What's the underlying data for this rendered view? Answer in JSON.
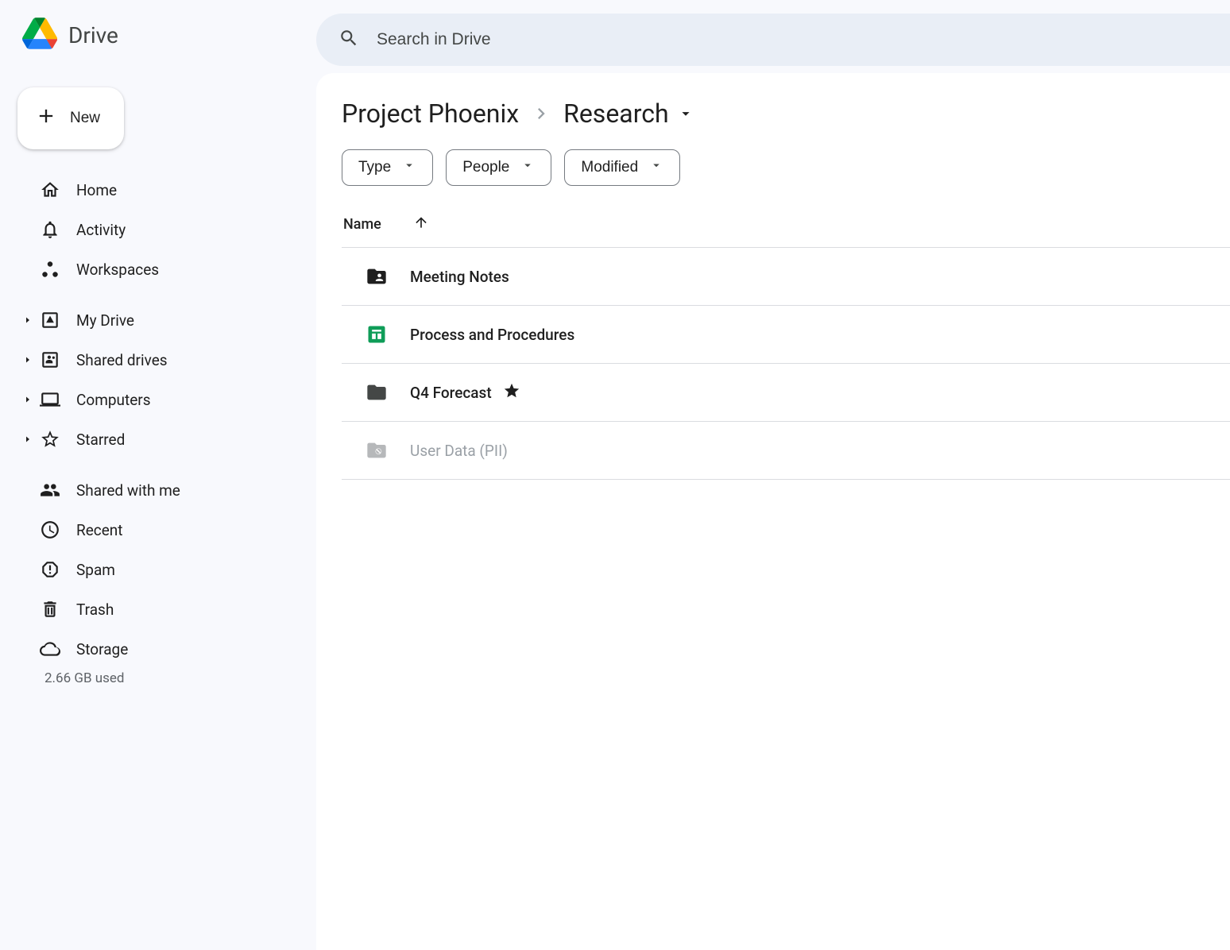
{
  "app": {
    "name": "Drive"
  },
  "search": {
    "placeholder": "Search in Drive"
  },
  "new_button": "New",
  "sidebar": {
    "primary": [
      {
        "label": "Home"
      },
      {
        "label": "Activity"
      },
      {
        "label": "Workspaces"
      }
    ],
    "locations": [
      {
        "label": "My Drive"
      },
      {
        "label": "Shared drives"
      },
      {
        "label": "Computers"
      },
      {
        "label": "Starred"
      }
    ],
    "more": [
      {
        "label": "Shared with me"
      },
      {
        "label": "Recent"
      },
      {
        "label": "Spam"
      },
      {
        "label": "Trash"
      },
      {
        "label": "Storage"
      }
    ],
    "storage_used": "2.66 GB used"
  },
  "breadcrumb": {
    "parent": "Project Phoenix",
    "current": "Research"
  },
  "filters": [
    {
      "label": "Type"
    },
    {
      "label": "People"
    },
    {
      "label": "Modified"
    }
  ],
  "columns": {
    "name": "Name"
  },
  "files": [
    {
      "name": "Meeting Notes",
      "type": "shared-folder",
      "starred": false,
      "restricted": false
    },
    {
      "name": "Process and Procedures",
      "type": "sheet",
      "starred": false,
      "restricted": false
    },
    {
      "name": "Q4 Forecast",
      "type": "folder",
      "starred": true,
      "restricted": false
    },
    {
      "name": "User Data (PII)",
      "type": "restricted-folder",
      "starred": false,
      "restricted": true
    }
  ]
}
